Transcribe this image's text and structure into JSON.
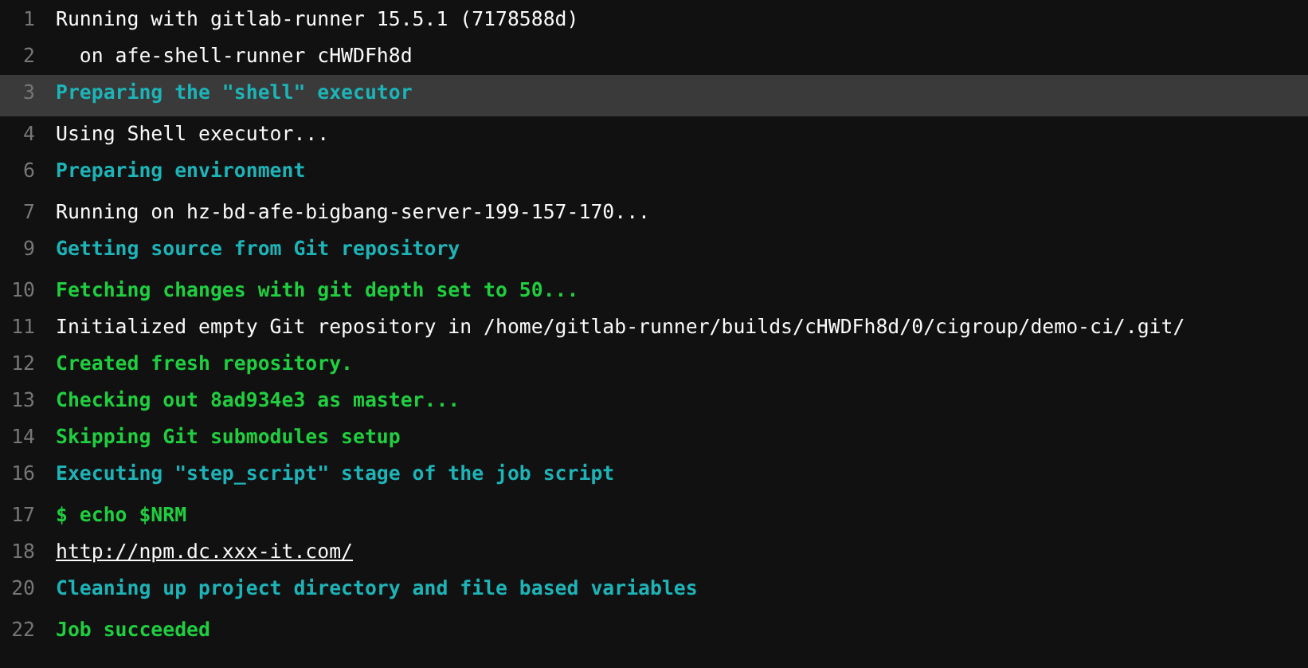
{
  "log_lines": [
    {
      "number": "1",
      "text": "Running with gitlab-runner 15.5.1 (7178588d)",
      "kind": "plain",
      "highlighted": false
    },
    {
      "number": "2",
      "text": "  on afe-shell-runner cHWDFh8d",
      "kind": "plain",
      "highlighted": false
    },
    {
      "number": "3",
      "text": "Preparing the \"shell\" executor",
      "kind": "section",
      "highlighted": true
    },
    {
      "number": "4",
      "text": "Using Shell executor...",
      "kind": "plain",
      "highlighted": false
    },
    {
      "number": "6",
      "text": "Preparing environment",
      "kind": "section",
      "highlighted": false
    },
    {
      "number": "7",
      "text": "Running on hz-bd-afe-bigbang-server-199-157-170...",
      "kind": "plain",
      "highlighted": false
    },
    {
      "number": "9",
      "text": "Getting source from Git repository",
      "kind": "section",
      "highlighted": false
    },
    {
      "number": "10",
      "text": "Fetching changes with git depth set to 50...",
      "kind": "success",
      "highlighted": false
    },
    {
      "number": "11",
      "text": "Initialized empty Git repository in /home/gitlab-runner/builds/cHWDFh8d/0/cigroup/demo-ci/.git/",
      "kind": "plain",
      "highlighted": false
    },
    {
      "number": "12",
      "text": "Created fresh repository.",
      "kind": "success",
      "highlighted": false
    },
    {
      "number": "13",
      "text": "Checking out 8ad934e3 as master...",
      "kind": "success",
      "highlighted": false
    },
    {
      "number": "14",
      "text": "Skipping Git submodules setup",
      "kind": "success",
      "highlighted": false
    },
    {
      "number": "16",
      "text": "Executing \"step_script\" stage of the job script",
      "kind": "section",
      "highlighted": false
    },
    {
      "number": "17",
      "text": "$ echo $NRM",
      "kind": "success",
      "highlighted": false
    },
    {
      "number": "18",
      "text": "http://npm.dc.xxx-it.com/",
      "kind": "link",
      "highlighted": false
    },
    {
      "number": "20",
      "text": "Cleaning up project directory and file based variables",
      "kind": "section",
      "highlighted": false
    },
    {
      "number": "22",
      "text": "Job succeeded",
      "kind": "success",
      "highlighted": false
    }
  ]
}
